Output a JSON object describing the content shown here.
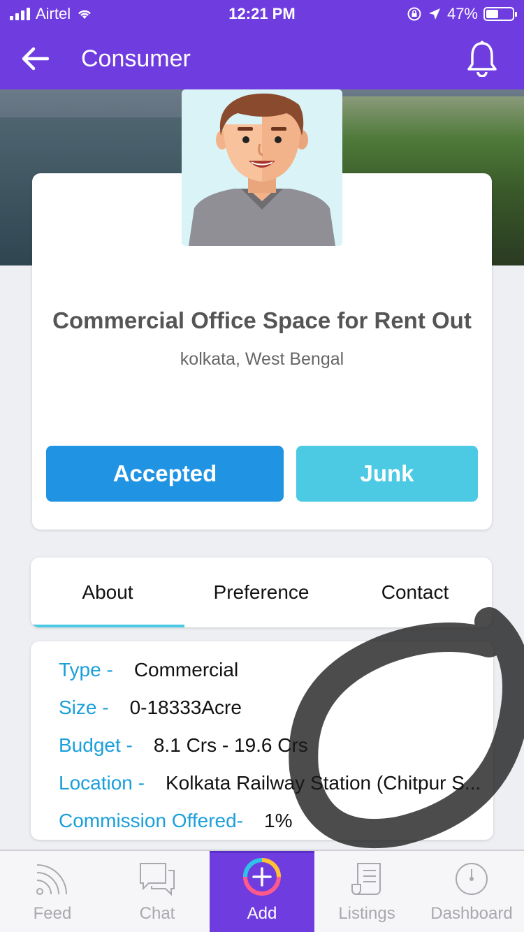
{
  "status_bar": {
    "carrier": "Airtel",
    "time": "12:21 PM",
    "battery": "47%",
    "battery_level": 0.47
  },
  "header": {
    "title": "Consumer",
    "back_icon": "arrow-left-icon",
    "bell_icon": "bell-icon"
  },
  "listing": {
    "title": "Commercial Office Space for Rent Out",
    "location": "kolkata, West Bengal"
  },
  "actions": {
    "accepted_label": "Accepted",
    "junk_label": "Junk",
    "accepted_color": "#2193e3",
    "junk_color": "#4cc9e3"
  },
  "tabs": [
    {
      "label": "About",
      "active": true
    },
    {
      "label": "Preference",
      "active": false
    },
    {
      "label": "Contact",
      "active": false
    }
  ],
  "details": [
    {
      "label": "Type -",
      "value": "Commercial"
    },
    {
      "label": "Size -",
      "value": "0-18333Acre"
    },
    {
      "label": "Budget -",
      "value": "8.1 Crs - 19.6 Crs"
    },
    {
      "label": "Location -",
      "value": "Kolkata Railway Station (Chitpur S..."
    },
    {
      "label": "Commission Offered-",
      "value": "1%"
    }
  ],
  "bottom_nav": [
    {
      "label": "Feed",
      "icon": "rss-feed-icon"
    },
    {
      "label": "Chat",
      "icon": "chat-icon"
    },
    {
      "label": "Add",
      "icon": "add-circle-icon"
    },
    {
      "label": "Listings",
      "icon": "listings-icon"
    },
    {
      "label": "Dashboard",
      "icon": "dashboard-gauge-icon"
    }
  ],
  "colors": {
    "brand_purple": "#6f3ce0",
    "label_blue": "#1a9fdb"
  }
}
